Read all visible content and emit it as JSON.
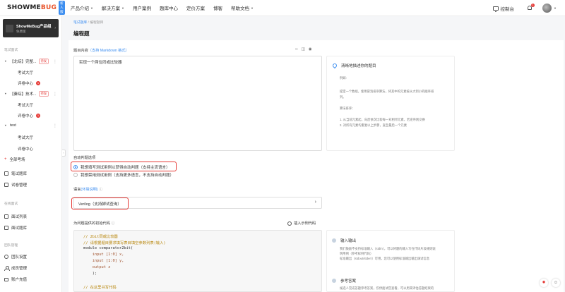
{
  "brand": {
    "logo_main": "SHOWME",
    "logo_accent": "BUG",
    "badge": "新人版"
  },
  "nav": {
    "items": [
      {
        "label": "产品介绍",
        "dropdown": true
      },
      {
        "label": "解决方案",
        "dropdown": true
      },
      {
        "label": "用户案例",
        "dropdown": false
      },
      {
        "label": "题库中心",
        "dropdown": false
      },
      {
        "label": "定价方案",
        "dropdown": false
      },
      {
        "label": "博客",
        "dropdown": false
      },
      {
        "label": "帮助文档",
        "dropdown": true
      }
    ],
    "console_label": "控制台",
    "notification_count": "1"
  },
  "sidebar": {
    "org_name": "ShowMeBug产品组",
    "org_sub": "免费版",
    "section_written": "笔试面试",
    "tests": [
      {
        "name": "【北综】完整...",
        "tag": "待发"
      },
      {
        "name": "【秦综】技术...",
        "tag": "待发"
      },
      {
        "name": "test",
        "tag": ""
      }
    ],
    "sub_lobby": "考试大厅",
    "sub_review": "评卷中心",
    "review_badge": "1",
    "all_exams": "全部考场",
    "exam_bank": "笔试题库",
    "paper_mgmt": "试卷管理",
    "section_interview": "在线面试",
    "interview_list": "面试列表",
    "interview_bank": "面试题库",
    "section_team": "团队管理",
    "team_settings": "团队设置",
    "member_mgmt": "成员管理",
    "account_recharge": "账户充值"
  },
  "breadcrumb": {
    "parent": "笔试题库",
    "separator": "/",
    "current": "编程题目"
  },
  "page": {
    "title": "编程题"
  },
  "question": {
    "label_prefix": "题目内容",
    "label_link": "（支持 Markdown 格式）",
    "content": "实现一个两位同或比较器"
  },
  "tips": {
    "title": "清晰地描述你的题目",
    "lines": [
      "例如:",
      "",
      "提定一个数组，使用冒泡排序算法，将其中的元素按从大到小的顺序排",
      "列。",
      "",
      "算法排序：",
      "",
      "1. 从当前元素起，向后依次比较每一对相邻元素，若逆序则交换",
      "2. 对所有元素均重复以上步骤，直至最后一个元素"
    ]
  },
  "auto_judge": {
    "label": "自动判题选项",
    "option1": "我想填写测试用例以获得自动判题（支持主流语言）",
    "option2": "我想禁用测试用例（支持更多语言，不支持自动判题）",
    "selected": 1
  },
  "language": {
    "label_prefix": "语言",
    "label_link": "(环境说明)",
    "value": "Verilog（支持脚试查询）"
  },
  "code": {
    "label": "为问题提供的初始代码",
    "insert_link": "插入示例代码",
    "lines": [
      {
        "text": "// 2bit同或比较器",
        "color": "#b8860b"
      },
      {
        "text": "// 请根据题目要求填写表目填空参数列表(输入)",
        "color": "#b8860b"
      },
      {
        "text": "module comparator2bit(",
        "color": "#333333"
      },
      {
        "text": "    input [1:0] x,",
        "color": "#a0522d"
      },
      {
        "text": "    input [1:0] y,",
        "color": "#a0522d"
      },
      {
        "text": "    output z",
        "color": "#a0522d"
      },
      {
        "text": "    );",
        "color": "#333333"
      },
      {
        "text": "",
        "color": "#333333"
      },
      {
        "text": "// 在这里书写代码",
        "color": "#b8860b"
      }
    ]
  },
  "io": {
    "title": "输入输出",
    "lines": [
      "我们鼓励不支持标准输入（stdin），可以将题的输入写在代码片段规则说",
      "明用例（参考样例代码）",
      "标准输出（stdout/stderr）可用，您可以使用标准输出输出调试信息"
    ],
    "ref_title": "参考答案",
    "ref_line": "候选人完成答题参考答案，仅供面试官查看，可以用来评估答题结果的"
  },
  "colors": {
    "accent": "#3d8ef0",
    "danger": "#e53935"
  }
}
